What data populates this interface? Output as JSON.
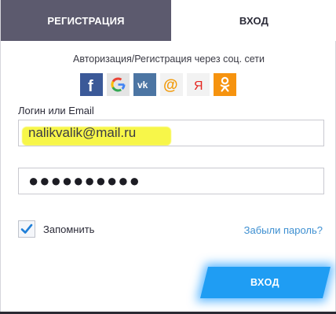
{
  "tabs": {
    "register_label": "РЕГИСТРАЦИЯ",
    "login_label": "ВХОД"
  },
  "social": {
    "caption": "Авторизация/Регистрация через соц. сети",
    "providers": [
      {
        "name": "facebook-icon",
        "glyph": "f",
        "color": "#3b5998"
      },
      {
        "name": "google-icon",
        "glyph": "G",
        "color": "#e4e4e4"
      },
      {
        "name": "vk-icon",
        "glyph": "vk",
        "color": "#4c75a3"
      },
      {
        "name": "mailru-icon",
        "glyph": "@",
        "color": "#f2f2f2"
      },
      {
        "name": "yandex-icon",
        "glyph": "Я",
        "color": "#f2f2f2"
      },
      {
        "name": "odnoklassniki-icon",
        "glyph": "ок",
        "color": "#f6930f"
      }
    ]
  },
  "form": {
    "login_label": "Логин или Email",
    "login_value": "nalikvalik@mail.ru",
    "password_value": "●●●●●●●●●●",
    "remember_label": "Запомнить",
    "remember_checked": true,
    "forgot_label": "Забыли пароль?",
    "submit_label": "ВХОД"
  },
  "colors": {
    "accent_blue": "#1f9df3",
    "tab_inactive": "#5c5a6e",
    "link": "#3d8fd1",
    "highlight": "#f6f52a"
  }
}
